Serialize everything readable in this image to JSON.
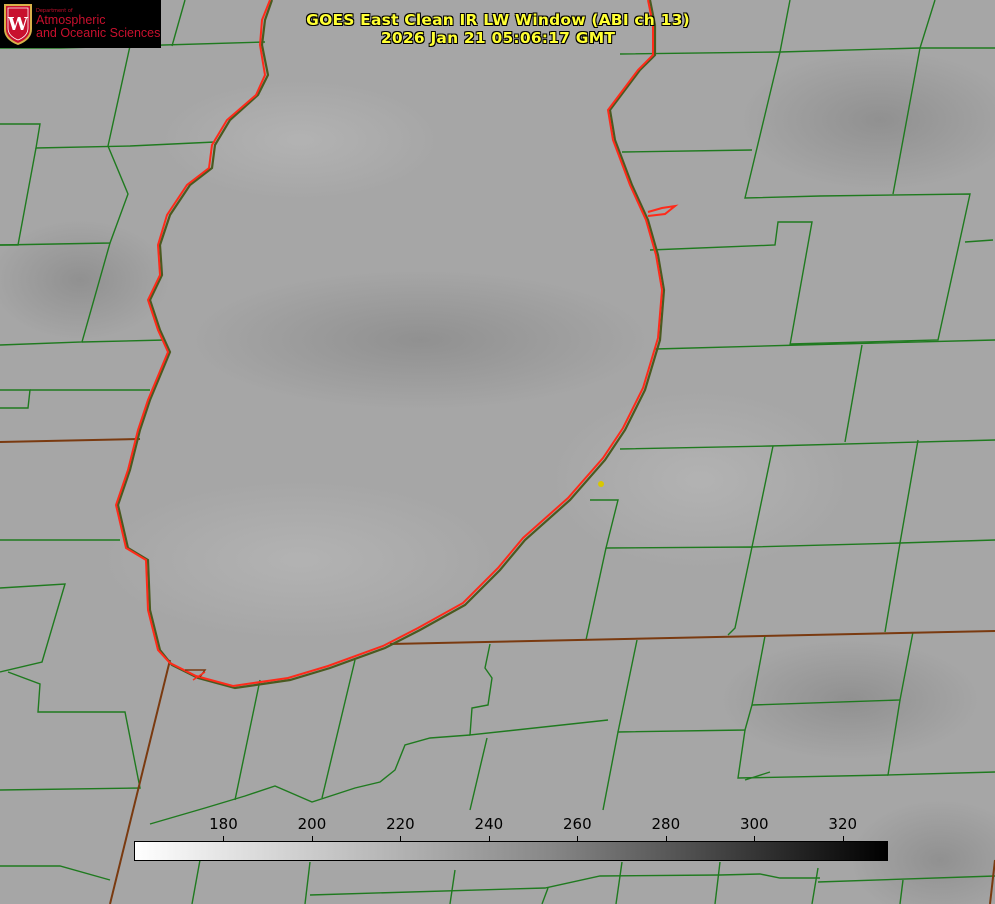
{
  "logo": {
    "department": "Department of",
    "line1": "Atmospheric",
    "line2": "and Oceanic Sciences",
    "crest_letter": "W"
  },
  "title": {
    "line1": "GOES East Clean IR LW Window (ABI ch 13)",
    "line2": "2026 Jan 21 05:06:17 GMT"
  },
  "colorbar": {
    "min": 160,
    "max": 330,
    "ticks": [
      "180",
      "200",
      "220",
      "240",
      "260",
      "280",
      "300",
      "320"
    ]
  },
  "colors": {
    "background": "#a4a4a4",
    "county_lines": "#1f7a1f",
    "coastline": "#ff2a1a",
    "state_lines": "#7a3a10",
    "title_text": "#ffff33",
    "logo_text": "#c8102e"
  }
}
